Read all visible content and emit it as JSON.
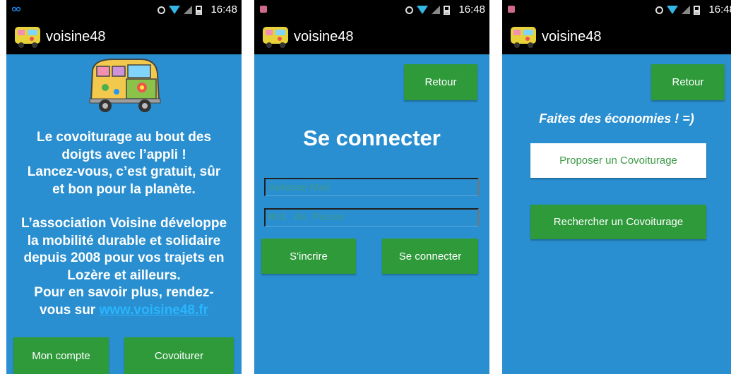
{
  "app": {
    "name": "voisine48",
    "time": "16:48"
  },
  "screen1": {
    "intro_lines_1": [
      "Le covoiturage au bout des",
      "doigts avec l’appli !",
      "Lancez-vous, c’est gratuit, sûr",
      "et bon pour la planète."
    ],
    "intro_lines_2": [
      "L’association Voisine développe",
      "la mobilité durable et solidaire",
      "depuis 2008 pour vos trajets en",
      "Lozère et ailleurs.",
      "Pour en savoir plus, rendez-"
    ],
    "link_prefix": "vous sur",
    "link_text": "www.voisine48.fr",
    "btn_account": "Mon compte",
    "btn_carpool": "Covoiturer"
  },
  "screen2": {
    "btn_back": "Retour",
    "title": "Se connecter",
    "email_placeholder": "Adresse Mail",
    "password_placeholder": "Mot de Passe",
    "btn_register": "S'incrire",
    "btn_login": "Se connecter"
  },
  "screen3": {
    "btn_back": "Retour",
    "tagline": "Faites des économies ! =)",
    "btn_offer": "Proposer un Covoiturage",
    "btn_search": "Rechercher un Covoiturage"
  },
  "colors": {
    "background": "#2a8fd0",
    "button": "#2e9a3a",
    "link": "#29b6ff"
  },
  "icons": [
    "alarm-icon",
    "wifi-icon",
    "signal-icon",
    "battery-icon",
    "van-icon"
  ]
}
